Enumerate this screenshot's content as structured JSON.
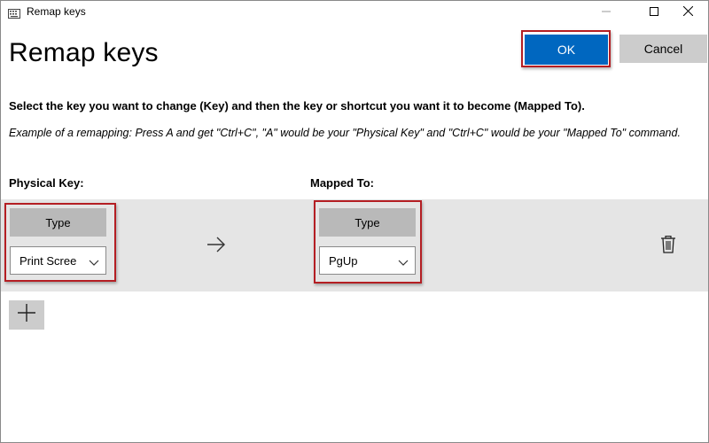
{
  "window": {
    "title": "Remap keys",
    "controls": {
      "minimize_icon": "minimize-icon",
      "maximize_icon": "maximize-icon",
      "close_icon": "close-icon"
    }
  },
  "header": {
    "title": "Remap keys",
    "ok_label": "OK",
    "cancel_label": "Cancel"
  },
  "instructions": {
    "main": "Select the key you want to change (Key) and then the key or shortcut you want it to become (Mapped To).",
    "example": "Example of a remapping: Press A and get \"Ctrl+C\", \"A\" would be your \"Physical Key\" and \"Ctrl+C\" would be your \"Mapped To\" command."
  },
  "columns": {
    "physical_label": "Physical Key:",
    "mapped_label": "Mapped To:"
  },
  "remapping": {
    "physical": {
      "type_label": "Type",
      "selected": "Print Scree"
    },
    "mapped": {
      "type_label": "Type",
      "selected": "PgUp"
    },
    "arrow_icon": "right-arrow-icon",
    "delete_icon": "trash-icon"
  },
  "add": {
    "icon": "plus-icon"
  },
  "colors": {
    "accent": "#0067c0",
    "highlight": "#b41e23",
    "band": "#e5e5e5",
    "button_gray": "#cccccc",
    "type_button": "#b9b9b9"
  }
}
